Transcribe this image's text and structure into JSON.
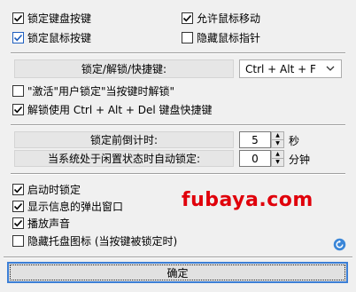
{
  "options": {
    "lock_keyboard": {
      "label": "锁定键盘按键",
      "checked": true
    },
    "allow_mouse_move": {
      "label": "允许鼠标移动",
      "checked": true
    },
    "lock_mouse": {
      "label": "锁定鼠标按键",
      "checked": true
    },
    "hide_cursor": {
      "label": "隐藏鼠标指针",
      "checked": false
    }
  },
  "hotkey": {
    "label": "锁定/解锁/快捷键:",
    "value": "Ctrl + Alt + F"
  },
  "unlock_options": {
    "activate_user_lock": {
      "label": "\"激活\"用户锁定\"当按键时解锁\"",
      "checked": false
    },
    "use_ctrl_alt_del": {
      "label": "解锁使用 Ctrl + Alt + Del 键盘快捷键",
      "checked": true
    }
  },
  "timers": {
    "countdown": {
      "label": "锁定前倒计时:",
      "value": "5",
      "unit": "秒"
    },
    "idle": {
      "label": "当系统处于闲置状态时自动锁定:",
      "value": "0",
      "unit": "分钟"
    }
  },
  "misc": {
    "lock_on_start": {
      "label": "启动时锁定",
      "checked": true
    },
    "show_popup": {
      "label": "显示信息的弹出窗口",
      "checked": true
    },
    "play_sound": {
      "label": "播放声音",
      "checked": true
    },
    "hide_tray": {
      "label": "隐藏托盘图标 (当按键被锁定时)",
      "checked": false
    }
  },
  "watermark": "fubaya.com",
  "ok_label": "确定",
  "icons": {
    "check": "check-icon",
    "dropdown": "chevron-down-icon",
    "reset": "refresh-icon"
  },
  "colors": {
    "accent": "#3c7fd6",
    "watermark": "#e0000b",
    "background": "#f0f0f0"
  }
}
